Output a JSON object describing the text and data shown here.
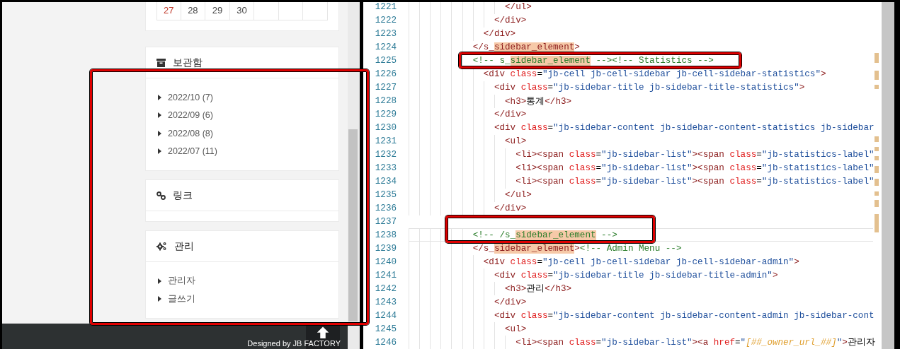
{
  "blog": {
    "calendar_row": [
      {
        "day": "27",
        "sunday": true
      },
      {
        "day": "28",
        "sunday": false
      },
      {
        "day": "29",
        "sunday": false
      },
      {
        "day": "30",
        "sunday": false
      }
    ],
    "widgets": [
      {
        "kind": "archive",
        "title": "보관함",
        "items": [
          "2022/10 (7)",
          "2022/09 (6)",
          "2022/08 (8)",
          "2022/07 (11)"
        ]
      },
      {
        "kind": "link",
        "title": "링크"
      },
      {
        "kind": "admin",
        "title": "관리",
        "items": [
          "관리자",
          "글쓰기"
        ]
      }
    ],
    "footer": {
      "credit": "Designed by JB FACTORY"
    }
  },
  "editor": {
    "lines": [
      {
        "number": "1221",
        "current": false,
        "tokens": [
          {
            "kind": "tag",
            "text": "                  </ul>"
          }
        ]
      },
      {
        "number": "1222",
        "current": false,
        "tokens": [
          {
            "kind": "tag",
            "text": "                </div>"
          }
        ]
      },
      {
        "number": "1223",
        "current": false,
        "tokens": [
          {
            "kind": "tag",
            "text": "              </div>"
          }
        ]
      },
      {
        "number": "1224",
        "current": false,
        "tokens": [
          {
            "kind": "tag",
            "text": "            </s_"
          },
          {
            "kind": "tag_match",
            "text": "sidebar_element"
          },
          {
            "kind": "tag",
            "text": ">"
          }
        ]
      },
      {
        "number": "1225",
        "current": false,
        "tokens": [
          {
            "kind": "comment",
            "text": "            <!-- s_"
          },
          {
            "kind": "comment_match",
            "text": "sidebar_element"
          },
          {
            "kind": "comment",
            "text": " --><!-- Statistics -->"
          }
        ]
      },
      {
        "number": "1226",
        "current": false,
        "tokens": [
          {
            "kind": "tag",
            "text": "              <div "
          },
          {
            "kind": "attr",
            "text": "class"
          },
          {
            "kind": "text",
            "text": "="
          },
          {
            "kind": "value",
            "text": "\"jb-cell jb-cell-sidebar jb-cell-sidebar-statistics\""
          },
          {
            "kind": "tag",
            "text": ">"
          }
        ]
      },
      {
        "number": "1227",
        "current": false,
        "tokens": [
          {
            "kind": "tag",
            "text": "                <div "
          },
          {
            "kind": "attr",
            "text": "class"
          },
          {
            "kind": "text",
            "text": "="
          },
          {
            "kind": "value",
            "text": "\"jb-sidebar-title jb-sidebar-title-statistics\""
          },
          {
            "kind": "tag",
            "text": ">"
          }
        ]
      },
      {
        "number": "1228",
        "current": false,
        "tokens": [
          {
            "kind": "tag",
            "text": "                  <h3>"
          },
          {
            "kind": "text",
            "text": "통계"
          },
          {
            "kind": "tag",
            "text": "</h3>"
          }
        ]
      },
      {
        "number": "1229",
        "current": false,
        "tokens": [
          {
            "kind": "tag",
            "text": "                </div>"
          }
        ]
      },
      {
        "number": "1230",
        "current": false,
        "tokens": [
          {
            "kind": "tag",
            "text": "                <div "
          },
          {
            "kind": "attr",
            "text": "class"
          },
          {
            "kind": "text",
            "text": "="
          },
          {
            "kind": "value",
            "text": "\"jb-sidebar-content jb-sidebar-content-statistics jb-sidebar"
          }
        ]
      },
      {
        "number": "1231",
        "current": false,
        "tokens": [
          {
            "kind": "tag",
            "text": "                  <ul>"
          }
        ]
      },
      {
        "number": "1232",
        "current": false,
        "tokens": [
          {
            "kind": "tag",
            "text": "                    <li><span "
          },
          {
            "kind": "attr",
            "text": "class"
          },
          {
            "kind": "text",
            "text": "="
          },
          {
            "kind": "value",
            "text": "\"jb-sidebar-list\""
          },
          {
            "kind": "tag",
            "text": "><span "
          },
          {
            "kind": "attr",
            "text": "class"
          },
          {
            "kind": "text",
            "text": "="
          },
          {
            "kind": "value",
            "text": "\"jb-statistics-label\""
          }
        ]
      },
      {
        "number": "1233",
        "current": false,
        "tokens": [
          {
            "kind": "tag",
            "text": "                    <li><span "
          },
          {
            "kind": "attr",
            "text": "class"
          },
          {
            "kind": "text",
            "text": "="
          },
          {
            "kind": "value",
            "text": "\"jb-sidebar-list\""
          },
          {
            "kind": "tag",
            "text": "><span "
          },
          {
            "kind": "attr",
            "text": "class"
          },
          {
            "kind": "text",
            "text": "="
          },
          {
            "kind": "value",
            "text": "\"jb-statistics-label\""
          }
        ]
      },
      {
        "number": "1234",
        "current": false,
        "tokens": [
          {
            "kind": "tag",
            "text": "                    <li><span "
          },
          {
            "kind": "attr",
            "text": "class"
          },
          {
            "kind": "text",
            "text": "="
          },
          {
            "kind": "value",
            "text": "\"jb-sidebar-list\""
          },
          {
            "kind": "tag",
            "text": "><span "
          },
          {
            "kind": "attr",
            "text": "class"
          },
          {
            "kind": "text",
            "text": "="
          },
          {
            "kind": "value",
            "text": "\"jb-statistics-label\""
          }
        ]
      },
      {
        "number": "1235",
        "current": false,
        "tokens": [
          {
            "kind": "tag",
            "text": "                  </ul>"
          }
        ]
      },
      {
        "number": "1236",
        "current": false,
        "tokens": [
          {
            "kind": "tag",
            "text": "                </div>"
          }
        ]
      },
      {
        "number": "1237",
        "current": false
      },
      {
        "number": "1238",
        "current": true,
        "tokens": [
          {
            "kind": "comment",
            "text": "            <!-- /s_"
          },
          {
            "kind": "comment_match",
            "text": "sidebar_element"
          },
          {
            "kind": "comment",
            "text": " -->"
          }
        ]
      },
      {
        "number": "1239",
        "current": false,
        "tokens": [
          {
            "kind": "tag",
            "text": "            </s_"
          },
          {
            "kind": "tag_match",
            "text": "sidebar_element"
          },
          {
            "kind": "tag",
            "text": ">"
          },
          {
            "kind": "comment",
            "text": "<!-- Admin Menu -->"
          }
        ]
      },
      {
        "number": "1240",
        "current": false,
        "tokens": [
          {
            "kind": "tag",
            "text": "              <div "
          },
          {
            "kind": "attr",
            "text": "class"
          },
          {
            "kind": "text",
            "text": "="
          },
          {
            "kind": "value",
            "text": "\"jb-cell jb-cell-sidebar jb-cell-sidebar-admin\""
          },
          {
            "kind": "tag",
            "text": ">"
          }
        ]
      },
      {
        "number": "1241",
        "current": false,
        "tokens": [
          {
            "kind": "tag",
            "text": "                <div "
          },
          {
            "kind": "attr",
            "text": "class"
          },
          {
            "kind": "text",
            "text": "="
          },
          {
            "kind": "value",
            "text": "\"jb-sidebar-title jb-sidebar-title-admin\""
          },
          {
            "kind": "tag",
            "text": ">"
          }
        ]
      },
      {
        "number": "1242",
        "current": false,
        "tokens": [
          {
            "kind": "tag",
            "text": "                  <h3>"
          },
          {
            "kind": "text",
            "text": "관리"
          },
          {
            "kind": "tag",
            "text": "</h3>"
          }
        ]
      },
      {
        "number": "1243",
        "current": false,
        "tokens": [
          {
            "kind": "tag",
            "text": "                </div>"
          }
        ]
      },
      {
        "number": "1244",
        "current": false,
        "tokens": [
          {
            "kind": "tag",
            "text": "                <div "
          },
          {
            "kind": "attr",
            "text": "class"
          },
          {
            "kind": "text",
            "text": "="
          },
          {
            "kind": "value",
            "text": "\"jb-sidebar-content jb-sidebar-content-admin jb-sidebar-cont"
          }
        ]
      },
      {
        "number": "1245",
        "current": false,
        "tokens": [
          {
            "kind": "tag",
            "text": "                  <ul>"
          }
        ]
      },
      {
        "number": "1246",
        "current": false,
        "tokens": [
          {
            "kind": "tag",
            "text": "                    <li><span "
          },
          {
            "kind": "attr",
            "text": "class"
          },
          {
            "kind": "text",
            "text": "="
          },
          {
            "kind": "value",
            "text": "\"jb-sidebar-list\""
          },
          {
            "kind": "tag",
            "text": "><a "
          },
          {
            "kind": "attr",
            "text": "href"
          },
          {
            "kind": "text",
            "text": "="
          },
          {
            "kind": "value",
            "text": "\""
          },
          {
            "kind": "template",
            "text": "[##_owner_url_##]"
          },
          {
            "kind": "value",
            "text": "\""
          },
          {
            "kind": "tag",
            "text": ">"
          },
          {
            "kind": "text",
            "text": "관리자"
          }
        ]
      }
    ]
  }
}
